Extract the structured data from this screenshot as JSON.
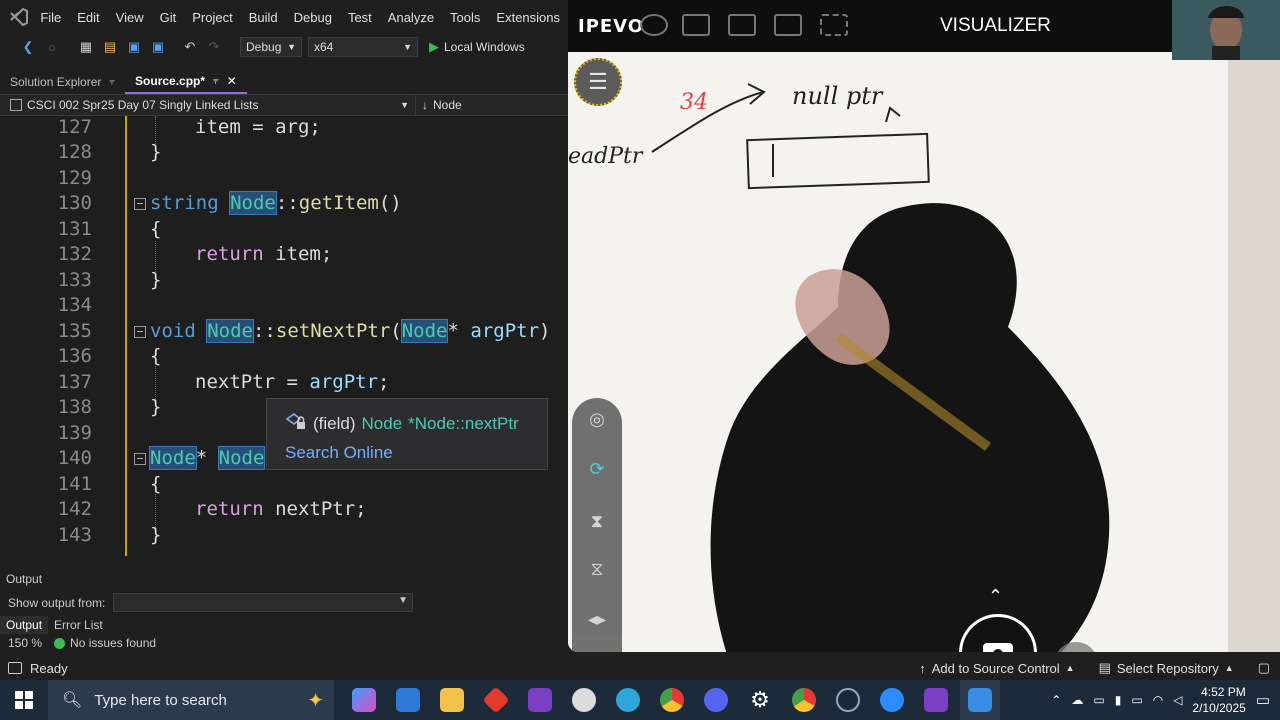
{
  "menubar": {
    "items": [
      "File",
      "Edit",
      "View",
      "Git",
      "Project",
      "Build",
      "Debug",
      "Test",
      "Analyze",
      "Tools",
      "Extensions"
    ]
  },
  "toolbar": {
    "config": "Debug",
    "platform": "x64",
    "run_label": "Local Windows"
  },
  "tabs": {
    "solution_explorer": "Solution Explorer",
    "source": "Source.cpp*"
  },
  "navbar": {
    "project": "CSCI 002 Spr25 Day 07 Singly Linked Lists",
    "member": "Node"
  },
  "editor": {
    "lines": [
      {
        "num": "127",
        "text": "item = arg;"
      },
      {
        "num": "128",
        "text": "}"
      },
      {
        "num": "129",
        "text": ""
      },
      {
        "num": "130",
        "text": "string Node::getItem()"
      },
      {
        "num": "131",
        "text": "{"
      },
      {
        "num": "132",
        "text": "return item;"
      },
      {
        "num": "133",
        "text": "}"
      },
      {
        "num": "134",
        "text": ""
      },
      {
        "num": "135",
        "text": "void Node::setNextPtr(Node* argPtr)"
      },
      {
        "num": "136",
        "text": "{"
      },
      {
        "num": "137",
        "text": "nextPtr = argPtr;"
      },
      {
        "num": "138",
        "text": "}"
      },
      {
        "num": "139",
        "text": ""
      },
      {
        "num": "140",
        "text": "Node* Node"
      },
      {
        "num": "141",
        "text": "{"
      },
      {
        "num": "142",
        "text": "return nextPtr;"
      },
      {
        "num": "143",
        "text": "}"
      }
    ]
  },
  "tooltip": {
    "kind": "(field)",
    "type": "Node",
    "signature": "*Node::nextPtr",
    "search": "Search Online"
  },
  "output": {
    "title": "Output",
    "show_from": "Show output from:",
    "tab_output": "Output",
    "tab_errors": "Error List",
    "zoom": "150 %",
    "issues": "No issues found"
  },
  "statusbar": {
    "ready": "Ready",
    "source_control": "Add to Source Control",
    "repository": "Select Repository"
  },
  "taskbar": {
    "search_placeholder": "Type here to search",
    "time": "4:52 PM",
    "date": "2/10/2025"
  },
  "visualizer": {
    "brand": "IPEVO",
    "title": "VISUALIZER",
    "writing": {
      "number": "34",
      "nullptr": "null ptr",
      "headptr": "eadPtr"
    }
  },
  "colors": {
    "keyword": "#569cd6",
    "type": "#4ec9b0",
    "function": "#dcdcaa",
    "accent": "#9b6bdf"
  }
}
